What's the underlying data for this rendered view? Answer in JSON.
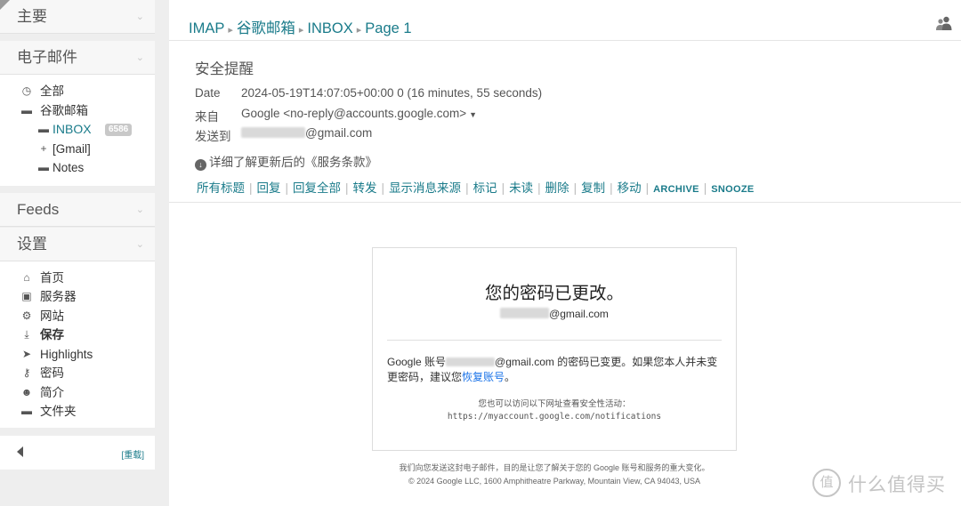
{
  "sidebar": {
    "main_header": "主要",
    "mail_header": "电子邮件",
    "mail_items": [
      {
        "label": "全部",
        "icon": "clock-icon"
      },
      {
        "label": "谷歌邮箱",
        "icon": "folder-icon"
      },
      {
        "label": "INBOX",
        "icon": "folder-icon",
        "badge": "6586",
        "active": true
      },
      {
        "label": "[Gmail]",
        "icon": "plus-icon"
      },
      {
        "label": "Notes",
        "icon": "folder-icon"
      }
    ],
    "feeds_header": "Feeds",
    "settings_header": "设置",
    "settings_items": [
      {
        "label": "首页",
        "icon": "home-icon"
      },
      {
        "label": "服务器",
        "icon": "monitor-icon"
      },
      {
        "label": "网站",
        "icon": "gear-icon"
      },
      {
        "label": "保存",
        "icon": "download-icon"
      },
      {
        "label": "Highlights",
        "icon": "tags-icon"
      },
      {
        "label": "密码",
        "icon": "key-icon"
      },
      {
        "label": "简介",
        "icon": "user-icon"
      },
      {
        "label": "文件夹",
        "icon": "folder-icon"
      }
    ],
    "reload": "[重载]"
  },
  "breadcrumb": [
    "IMAP",
    "谷歌邮箱",
    "INBOX",
    "Page 1"
  ],
  "message": {
    "subject": "安全提醒",
    "date_label": "Date",
    "date_value": "2024-05-19T14:07:05+00:00 0 (16 minutes, 55 seconds)",
    "from_label": "来自",
    "from_value": "Google <no-reply@accounts.google.com>",
    "to_label": "发送到",
    "to_domain": "@gmail.com",
    "tos_text": "详细了解更新后的《服务条款》"
  },
  "actions": [
    "所有标题",
    "回复",
    "回复全部",
    "转发",
    "显示消息来源",
    "标记",
    "未读",
    "删除",
    "复制",
    "移动",
    "ARCHIVE",
    "SNOOZE"
  ],
  "email": {
    "title": "您的密码已更改。",
    "addr_domain": "@gmail.com",
    "body_prefix": "Google 账号",
    "body_domain": "@gmail.com 的密码已变更。如果您本人并未变更密码，建议您",
    "body_link": "恢复账号",
    "body_suffix": "。",
    "note_line1": "您也可以访问以下网址查看安全性活动：",
    "note_line2": "https://myaccount.google.com/notifications"
  },
  "footer": {
    "line1": "我们向您发送这封电子邮件，目的是让您了解关于您的 Google 账号和服务的重大变化。",
    "line2": "© 2024 Google LLC, 1600 Amphitheatre Parkway, Mountain View, CA 94043, USA"
  },
  "watermark": {
    "text": "什么值得买"
  },
  "colors": {
    "link": "#1a7b8a",
    "email_link": "#1a73e8",
    "badge": "#c8c8c8"
  }
}
